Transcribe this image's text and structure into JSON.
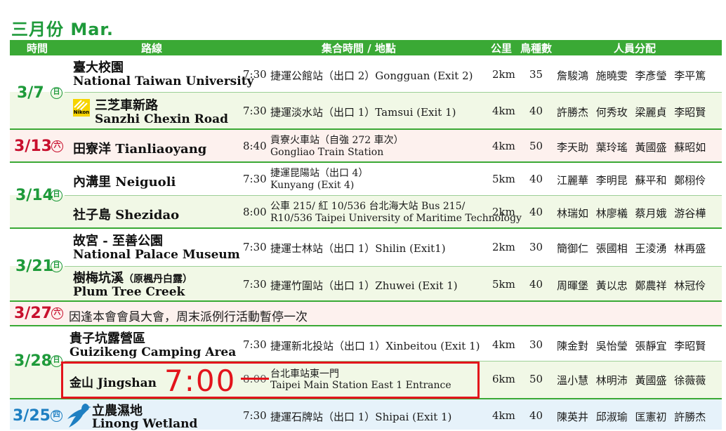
{
  "title": "三月份 Mar.",
  "headers": {
    "time": "時間",
    "route": "路線",
    "meet": "集合時間 / 地點",
    "km": "公里",
    "birds": "鳥種數",
    "staff": "人員分配"
  },
  "rows": {
    "r1": {
      "date": "3/7",
      "wk": "日",
      "zh": "臺大校園",
      "en": "National Taiwan University",
      "time": "7:30",
      "meet": "捷運公館站（出口 2）Gongguan (Exit 2)",
      "km": "2km",
      "birds": "35",
      "staff": "詹駿鴻 施曉雯 李彥瑩 李平篤"
    },
    "r2": {
      "zh": "三芝車新路",
      "en": "Sanzhi Chexin Road",
      "logo": "Nikon",
      "time": "7:30",
      "meet": "捷運淡水站（出口 1）Tamsui (Exit 1)",
      "km": "4km",
      "birds": "40",
      "staff": "許勝杰 何秀玫 梁麗貞 李昭賢"
    },
    "r3": {
      "date": "3/13",
      "wk": "六",
      "name": "田寮洋 Tianliaoyang",
      "time": "8:40",
      "meet1": "貢寮火車站（自強 272 車次）",
      "meet2": "Gongliao Train Station",
      "km": "4km",
      "birds": "50",
      "staff": "李天助 葉玲瑤 黃國盛 蘇昭如"
    },
    "r4": {
      "date": "3/14",
      "wk": "日",
      "name": "內溝里 Neiguoli",
      "time": "7:30",
      "meet1": "捷運昆陽站（出口 4）",
      "meet2": "Kunyang (Exit 4)",
      "km": "5km",
      "birds": "40",
      "staff": "江麗華 李明昆 蘇平和 鄭栩伶"
    },
    "r5": {
      "name": "社子島 Shezidao",
      "time": "8:00",
      "meet1": "公車 215/ 紅 10/536 台北海大站 Bus 215/",
      "meet2": "R10/536 Taipei University of Maritime Technology",
      "km": "2km",
      "birds": "40",
      "staff": "林瑞如 林廖檥 蔡月娥 游谷樺"
    },
    "r6": {
      "date": "3/21",
      "wk": "日",
      "zh": "故宮 - 至善公園",
      "en": "National Palace Museum",
      "time": "7:30",
      "meet": "捷運士林站（出口 1）Shilin (Exit1)",
      "km": "2km",
      "birds": "30",
      "staff": "簡御仁 張國相 王淩湧 林再盛"
    },
    "r7": {
      "zh": "樹梅坑溪",
      "zh_note": "（原楓丹白露）",
      "en": "Plum Tree Creek",
      "time": "7:30",
      "meet": "捷運竹圍站（出口 1）Zhuwei (Exit 1)",
      "km": "5km",
      "birds": "40",
      "staff": "周暉堡 黃以忠 鄭農祥 林冠伶"
    },
    "r8": {
      "date": "3/27",
      "wk": "六",
      "note": "因逢本會會員大會，周末派例行活動暫停一次"
    },
    "r9": {
      "date": "3/28",
      "wk": "日",
      "zh": "貴子坑露營區",
      "en": "Guizikeng Camping Area",
      "time": "7:30",
      "meet": "捷運新北投站（出口 1）Xinbeitou (Exit 1)",
      "km": "4km",
      "birds": "30",
      "staff": "陳金對 吳怡瑩 張靜宜 李昭賢"
    },
    "r10": {
      "name": "金山 Jingshan",
      "new_time": "7:00",
      "time": "8:00",
      "meet1": "台北車站東一門",
      "meet2": "Taipei Main Station East 1 Entrance",
      "km": "6km",
      "birds": "50",
      "staff": "溫小慧 林明沛 黃國盛 徐薇薇"
    },
    "r11": {
      "date": "3/25",
      "wk": "四",
      "zh": "立農濕地",
      "en": "Linong Wetland",
      "time": "7:30",
      "meet": "捷運石牌站（出口 1）Shipai (Exit 1)",
      "km": "4km",
      "birds": "40",
      "staff": "陳英井 邱淑瑜 匡憲初 許勝杰"
    }
  },
  "colors": {
    "green": "#3aa935",
    "date_green": "#1e9a3a",
    "date_red": "#c8102e",
    "highlight": "#e3141b",
    "band_green": "#f1f8e6",
    "band_red": "#fdf1ee",
    "band_blue": "#e6f2fa"
  }
}
